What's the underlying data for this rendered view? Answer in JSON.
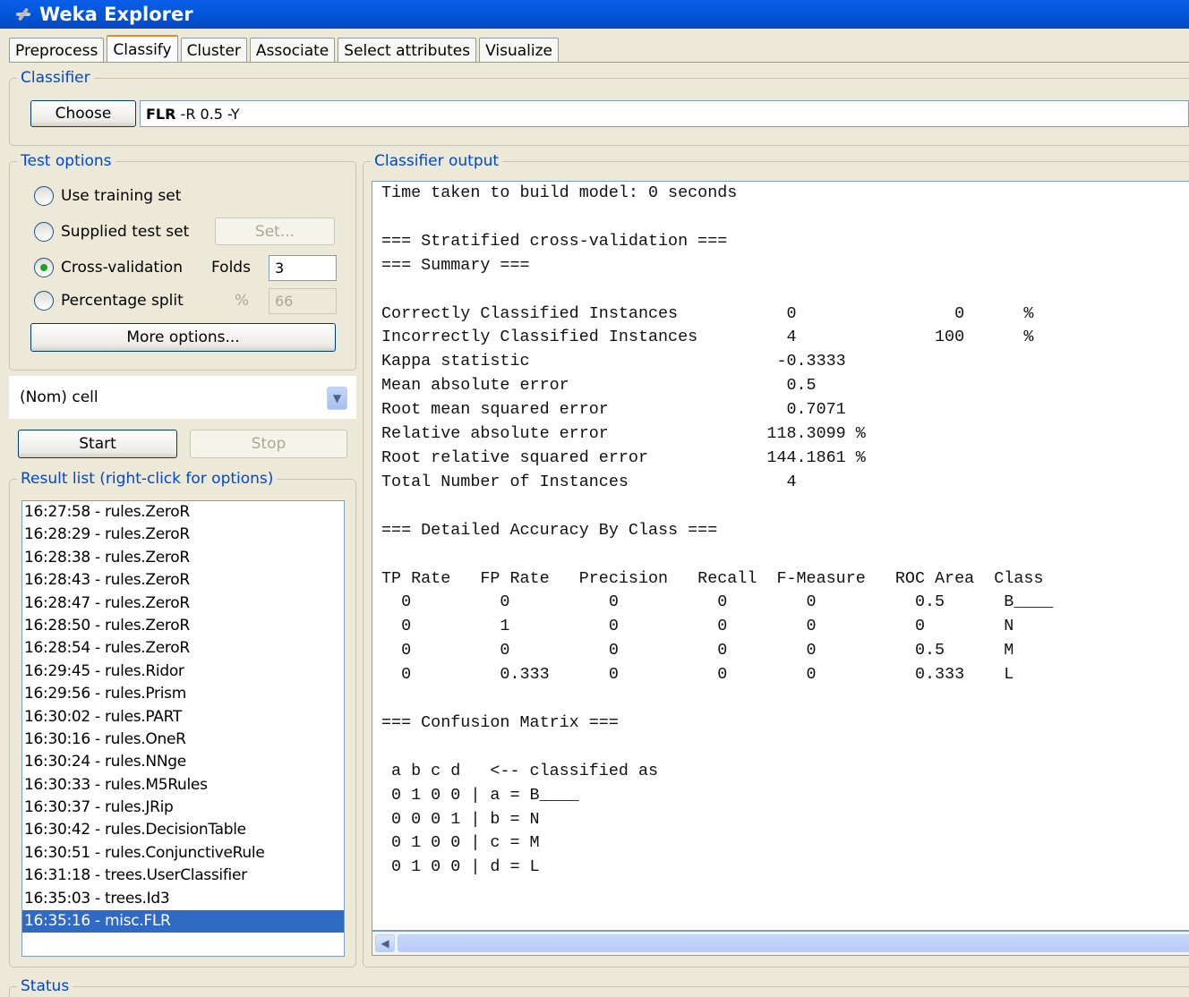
{
  "window": {
    "title": "Weka Explorer"
  },
  "tabs": [
    "Preprocess",
    "Classify",
    "Cluster",
    "Associate",
    "Select attributes",
    "Visualize"
  ],
  "active_tab": "Classify",
  "classifier": {
    "legend": "Classifier",
    "choose_label": "Choose",
    "name": "FLR",
    "options": " -R 0.5 -Y"
  },
  "test_options": {
    "legend": "Test options",
    "use_training_set": "Use training set",
    "supplied_test_set": "Supplied test set",
    "set_button": "Set...",
    "cross_validation": "Cross-validation",
    "folds_label": "Folds",
    "folds_value": "3",
    "percentage_split": "Percentage split",
    "percent_label": "%",
    "percent_value": "66",
    "more_options": "More options...",
    "selected": "cross_validation"
  },
  "class_selector": {
    "value": "(Nom) cell"
  },
  "actions": {
    "start": "Start",
    "stop": "Stop"
  },
  "result_list": {
    "legend": "Result list (right-click for options)",
    "items": [
      "16:27:58 - rules.ZeroR",
      "16:28:29 - rules.ZeroR",
      "16:28:38 - rules.ZeroR",
      "16:28:43 - rules.ZeroR",
      "16:28:47 - rules.ZeroR",
      "16:28:50 - rules.ZeroR",
      "16:28:54 - rules.ZeroR",
      "16:29:45 - rules.Ridor",
      "16:29:56 - rules.Prism",
      "16:30:02 - rules.PART",
      "16:30:16 - rules.OneR",
      "16:30:24 - rules.NNge",
      "16:30:33 - rules.M5Rules",
      "16:30:37 - rules.JRip",
      "16:30:42 - rules.DecisionTable",
      "16:30:51 - rules.ConjunctiveRule",
      "16:31:18 - trees.UserClassifier",
      "16:35:03 - trees.Id3",
      "16:35:16 - misc.FLR"
    ],
    "selected_index": 18
  },
  "output": {
    "legend": "Classifier output",
    "text": "Time taken to build model: 0 seconds\n\n=== Stratified cross-validation ===\n=== Summary ===\n\nCorrectly Classified Instances           0                0      %\nIncorrectly Classified Instances         4              100      %\nKappa statistic                         -0.3333\nMean absolute error                      0.5\nRoot mean squared error                  0.7071\nRelative absolute error                118.3099 %\nRoot relative squared error            144.1861 %\nTotal Number of Instances                4\n\n=== Detailed Accuracy By Class ===\n\nTP Rate   FP Rate   Precision   Recall  F-Measure   ROC Area  Class\n  0         0          0          0        0          0.5      B____\n  0         1          0          0        0          0        N\n  0         0          0          0        0          0.5      M\n  0         0.333      0          0        0          0.333    L\n\n=== Confusion Matrix ===\n\n a b c d   <-- classified as\n 0 1 0 0 | a = B____\n 0 0 0 1 | b = N\n 0 1 0 0 | c = M\n 0 1 0 0 | d = L"
  },
  "status": {
    "legend": "Status"
  },
  "colors": {
    "title_bar": "#0053d6",
    "legend_text": "#0046d5",
    "selection": "#316ac5",
    "background": "#ece9d8"
  }
}
